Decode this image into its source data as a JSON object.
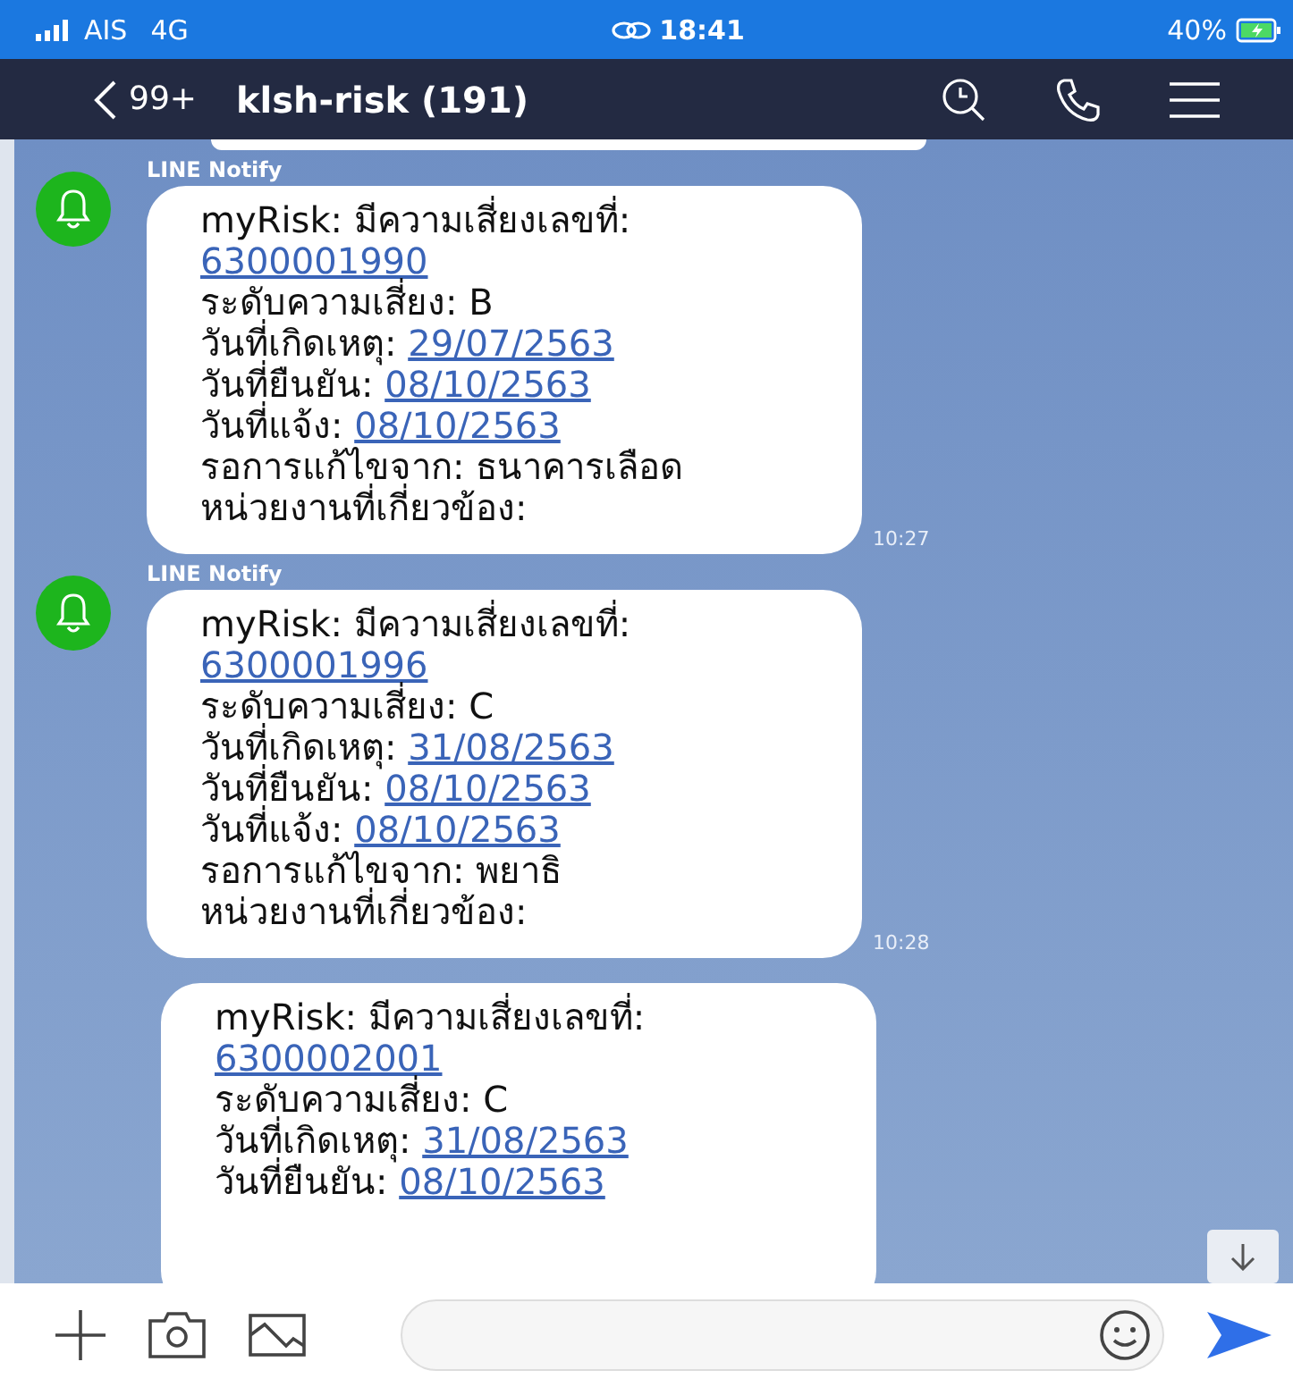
{
  "status_bar": {
    "carrier": "AIS",
    "network": "4G",
    "time": "18:41",
    "battery": "40%"
  },
  "header": {
    "unread": "99+",
    "title": "klsh-risk (191)"
  },
  "messages": [
    {
      "kind": "notify",
      "sender": "LINE Notify",
      "time": "10:27",
      "lines": [
        {
          "text": "myRisk: มีความเสี่ยงเลขที่:"
        },
        {
          "link": "6300001990"
        },
        {
          "text": "ระดับความเสี่ยง: B"
        },
        {
          "text": "วันที่เกิดเหตุ:",
          "link": "29/07/2563"
        },
        {
          "text": "วันที่ยืนยัน:",
          "link": "08/10/2563"
        },
        {
          "text": "วันที่แจ้ง:",
          "link": "08/10/2563"
        },
        {
          "text": "รอการแก้ไขจาก: ธนาคารเลือด"
        },
        {
          "text": "หน่วยงานที่เกี่ยวข้อง:"
        }
      ]
    },
    {
      "kind": "notify",
      "sender": "LINE Notify",
      "time": "10:28",
      "lines": [
        {
          "text": "myRisk: มีความเสี่ยงเลขที่:"
        },
        {
          "link": "6300001996"
        },
        {
          "text": "ระดับความเสี่ยง: C"
        },
        {
          "text": "วันที่เกิดเหตุ:",
          "link": "31/08/2563"
        },
        {
          "text": "วันที่ยืนยัน:",
          "link": "08/10/2563"
        },
        {
          "text": "วันที่แจ้ง:",
          "link": "08/10/2563"
        },
        {
          "text": "รอการแก้ไขจาก: พยาธิ"
        },
        {
          "text": "หน่วยงานที่เกี่ยวข้อง:"
        }
      ]
    },
    {
      "kind": "continued",
      "lines": [
        {
          "text": "myRisk: มีความเสี่ยงเลขที่:"
        },
        {
          "link": "6300002001"
        },
        {
          "text": "ระดับความเสี่ยง: C"
        },
        {
          "text": "วันที่เกิดเหตุ:",
          "link": "31/08/2563"
        },
        {
          "text": "วันที่ยืนยัน:",
          "link": "08/10/2563"
        }
      ]
    }
  ]
}
